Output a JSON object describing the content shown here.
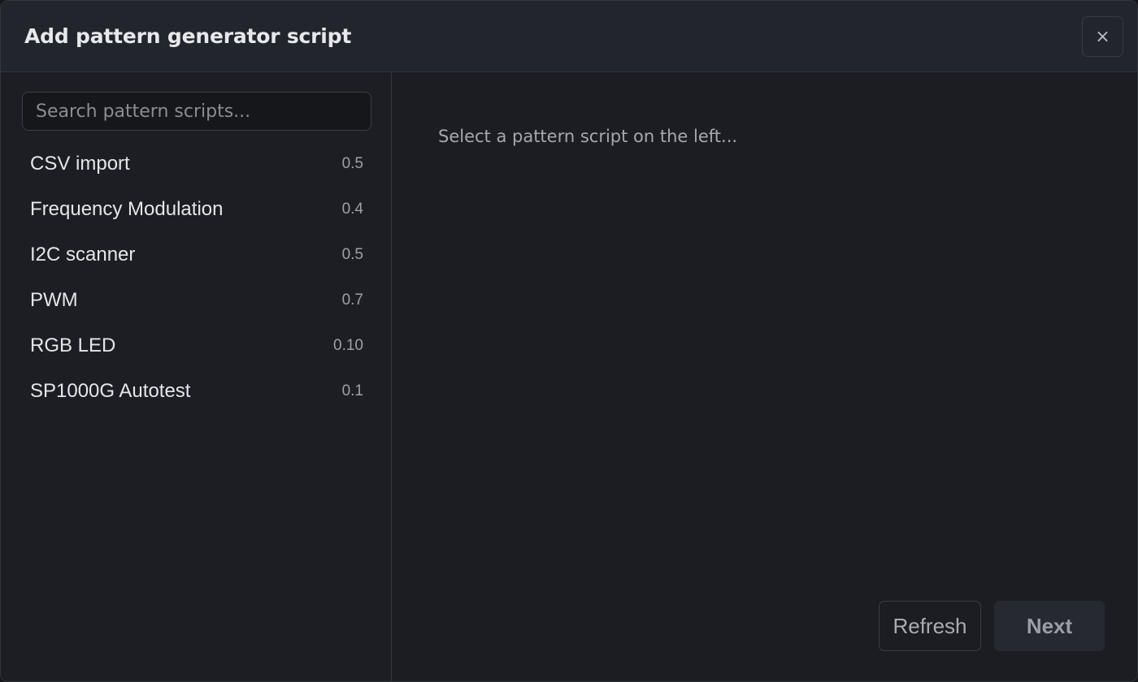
{
  "dialog": {
    "title": "Add pattern generator script",
    "close_label": "×"
  },
  "search": {
    "placeholder": "Search pattern scripts...",
    "value": ""
  },
  "scripts": [
    {
      "name": "CSV import",
      "version": "0.5"
    },
    {
      "name": "Frequency Modulation",
      "version": "0.4"
    },
    {
      "name": "I2C scanner",
      "version": "0.5"
    },
    {
      "name": "PWM",
      "version": "0.7"
    },
    {
      "name": "RGB LED",
      "version": "0.10"
    },
    {
      "name": "SP1000G Autotest",
      "version": "0.1"
    }
  ],
  "detail": {
    "empty_text": "Select a pattern script on the left..."
  },
  "footer": {
    "refresh_label": "Refresh",
    "next_label": "Next"
  }
}
